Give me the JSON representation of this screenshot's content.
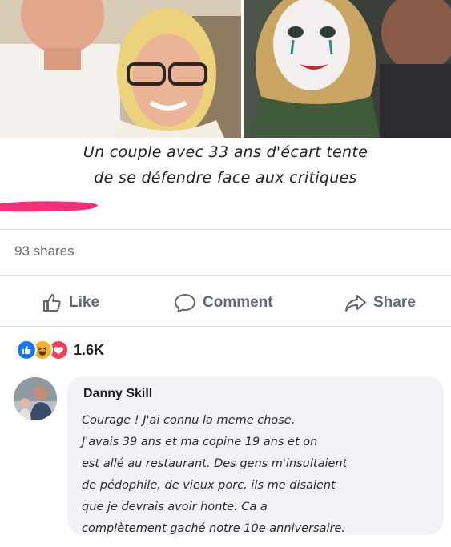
{
  "post": {
    "headline_lines": [
      "Un couple avec 33 ans d'écart tente",
      "de se défendre face aux critiques"
    ],
    "shares_text": "93 shares"
  },
  "actions": {
    "like": "Like",
    "comment": "Comment",
    "share": "Share"
  },
  "reactions": {
    "count": "1.6K",
    "icons": [
      "like-reaction",
      "haha-reaction",
      "love-reaction"
    ]
  },
  "comment": {
    "author": "Danny Skill",
    "lines": [
      "Courage ! J'ai connu la meme chose.",
      "J'avais 39 ans et ma copine 19 ans et on",
      "est allé au restaurant. Des gens m'insultaient",
      "de pédophile, de vieux porc, ils me disaient",
      "que je devrais avoir honte. Ca a",
      "complètement gaché notre 10e anniversaire."
    ]
  },
  "colors": {
    "facebook_blue": "#1877f2",
    "muted_text": "#606770",
    "comment_bubble": "#f0f2f5",
    "pink_marker": "#f0307a"
  }
}
